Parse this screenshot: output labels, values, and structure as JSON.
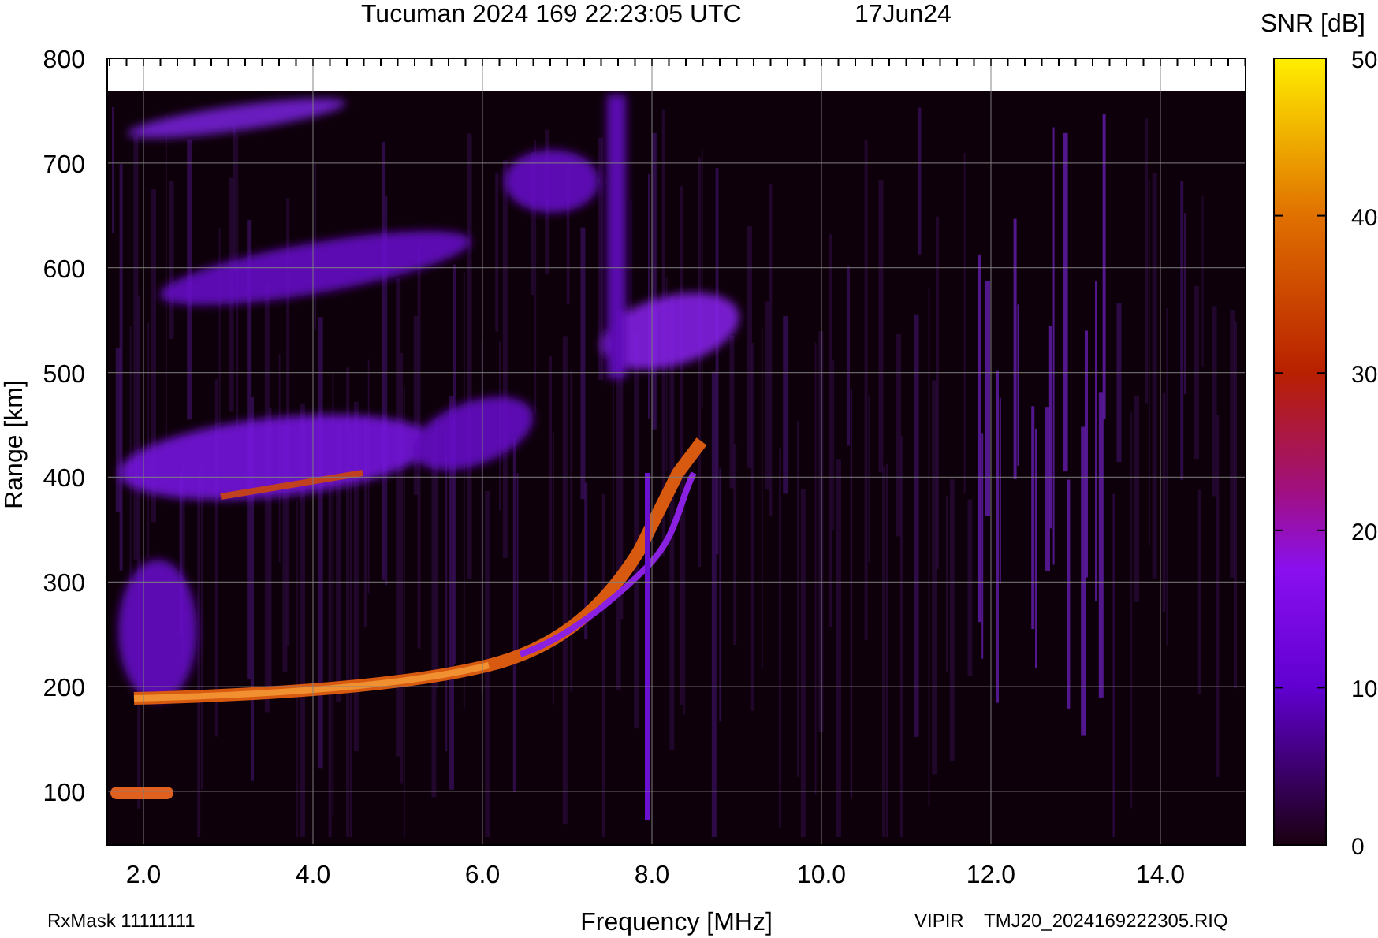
{
  "title": {
    "station": "Tucuman 2024 169 22:23:05 UTC",
    "date": "17Jun24"
  },
  "y_axis": {
    "label": "Range [km]",
    "ticks": [
      "800",
      "700",
      "600",
      "500",
      "400",
      "300",
      "200",
      "100"
    ]
  },
  "x_axis": {
    "label": "Frequency [MHz]",
    "ticks": [
      "2.0",
      "4.0",
      "6.0",
      "8.0",
      "10.0",
      "12.0",
      "14.0"
    ]
  },
  "colorbar": {
    "label": "SNR [dB]",
    "ticks": [
      "50",
      "40",
      "30",
      "20",
      "10",
      "0"
    ]
  },
  "footer": {
    "rx_mask": "RxMask 11111111",
    "instrument": "VIPIR",
    "file": "TMJ20_2024169222305.RIQ"
  }
}
